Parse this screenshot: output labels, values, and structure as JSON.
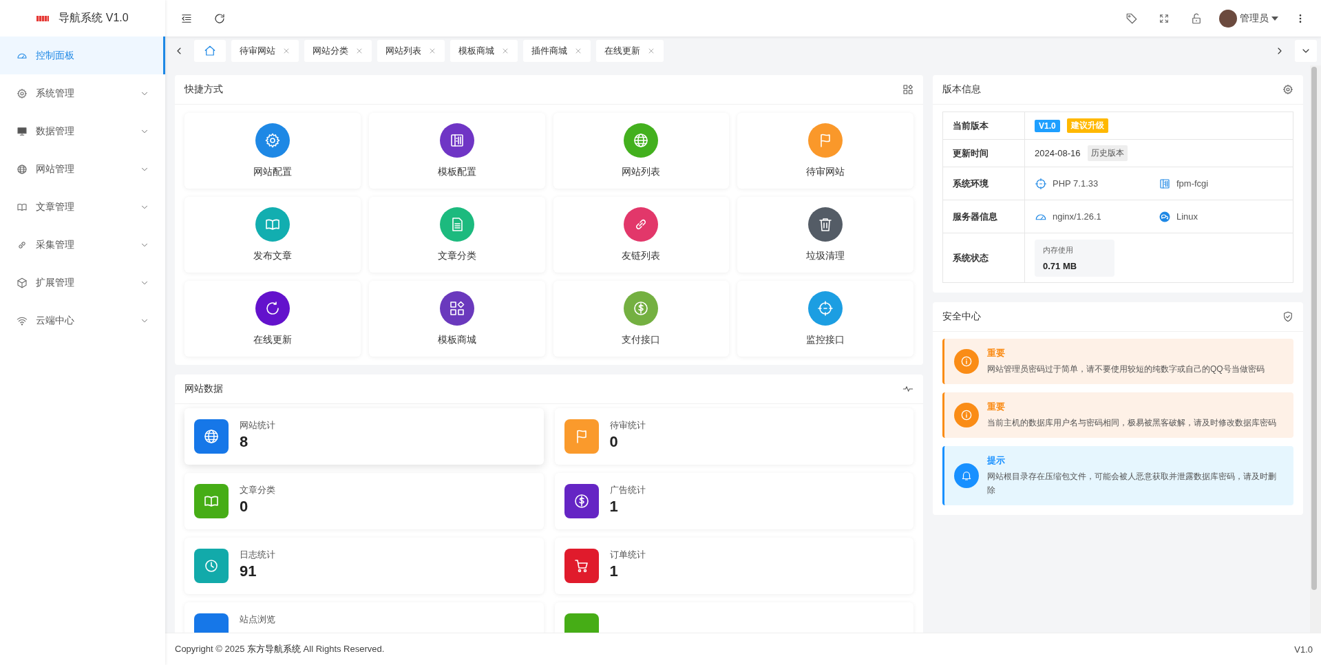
{
  "brand": {
    "title": "导航系统 V1.0"
  },
  "sidebar": {
    "items": [
      {
        "label": "控制面板",
        "selected": true
      },
      {
        "label": "系统管理",
        "selected": false,
        "expanded": false
      },
      {
        "label": "数据管理",
        "selected": false,
        "expanded": false
      },
      {
        "label": "网站管理",
        "selected": false,
        "expanded": false
      },
      {
        "label": "文章管理",
        "selected": false,
        "expanded": false
      },
      {
        "label": "采集管理",
        "selected": false,
        "expanded": false
      },
      {
        "label": "扩展管理",
        "selected": false,
        "expanded": false
      },
      {
        "label": "云端中心",
        "selected": false,
        "expanded": false
      }
    ]
  },
  "header": {
    "user": "管理员"
  },
  "tabs": [
    {
      "kind": "home",
      "selected": true
    },
    {
      "kind": "page",
      "label": "待审网站",
      "selected": false
    },
    {
      "kind": "page",
      "label": "网站分类",
      "selected": false
    },
    {
      "kind": "page",
      "label": "网站列表",
      "selected": false
    },
    {
      "kind": "page",
      "label": "模板商城",
      "selected": false
    },
    {
      "kind": "page",
      "label": "插件商城",
      "selected": false
    },
    {
      "kind": "page",
      "label": "在线更新",
      "selected": false
    }
  ],
  "shortcuts": {
    "title": "快捷方式",
    "items": [
      {
        "label": "网站配置",
        "color": "#1e88e5"
      },
      {
        "label": "模板配置",
        "color": "#6f35c5"
      },
      {
        "label": "网站列表",
        "color": "#43b01e"
      },
      {
        "label": "待审网站",
        "color": "#fa982a"
      },
      {
        "label": "发布文章",
        "color": "#12aeb0"
      },
      {
        "label": "文章分类",
        "color": "#1cba7e"
      },
      {
        "label": "友链列表",
        "color": "#e2376a"
      },
      {
        "label": "垃圾清理",
        "color": "#545c66"
      },
      {
        "label": "在线更新",
        "color": "#6312cc"
      },
      {
        "label": "模板商城",
        "color": "#6a39bd"
      },
      {
        "label": "支付接口",
        "color": "#74b041"
      },
      {
        "label": "监控接口",
        "color": "#1c9ee2"
      }
    ]
  },
  "site_data": {
    "title": "网站数据",
    "items": [
      {
        "label": "网站统计",
        "value": "8",
        "color": "#1677e8"
      },
      {
        "label": "待审统计",
        "value": "0",
        "color": "#fa9a2c"
      },
      {
        "label": "文章分类",
        "value": "0",
        "color": "#46ad16"
      },
      {
        "label": "广告统计",
        "value": "1",
        "color": "#6525c4"
      },
      {
        "label": "日志统计",
        "value": "91",
        "color": "#12aaaa"
      },
      {
        "label": "订单统计",
        "value": "1",
        "color": "#e01b2c"
      },
      {
        "label": "站点浏览",
        "color": "#1677e8"
      },
      {
        "color": "#46ad16"
      }
    ]
  },
  "version_info": {
    "title": "版本信息",
    "rows": [
      {
        "kind": "badges",
        "label": "当前版本",
        "badges": [
          {
            "text": "V1.0",
            "color": "#1e9fff"
          },
          {
            "text": "建议升级",
            "color": "#ffb800"
          }
        ]
      },
      {
        "kind": "date",
        "label": "更新时间",
        "value": "2024-08-16",
        "tag": "历史版本"
      },
      {
        "kind": "pair",
        "label": "系统环境",
        "items": [
          "PHP 7.1.33",
          "fpm-fcgi"
        ]
      },
      {
        "kind": "pair",
        "label": "服务器信息",
        "items": [
          "nginx/1.26.1",
          "Linux"
        ]
      },
      {
        "kind": "stat",
        "label": "系统状态",
        "stat_label": "内存使用",
        "stat_value": "0.71 MB"
      }
    ]
  },
  "security": {
    "title": "安全中心",
    "alerts": [
      {
        "kind": "warning",
        "title": "重要",
        "text": "网站管理员密码过于简单，请不要使用较短的纯数字或自己的QQ号当做密码"
      },
      {
        "kind": "warning",
        "title": "重要",
        "text": "当前主机的数据库用户名与密码相同，极易被黑客破解，请及时修改数据库密码"
      },
      {
        "kind": "tip",
        "title": "提示",
        "text": "网站根目录存在压缩包文件，可能会被人恶意获取并泄露数据库密码，请及时删除"
      }
    ]
  },
  "footer": {
    "copyright": "Copyright © 2025 **东方导航系统** All Rights Reserved.",
    "version": "V1.0"
  }
}
